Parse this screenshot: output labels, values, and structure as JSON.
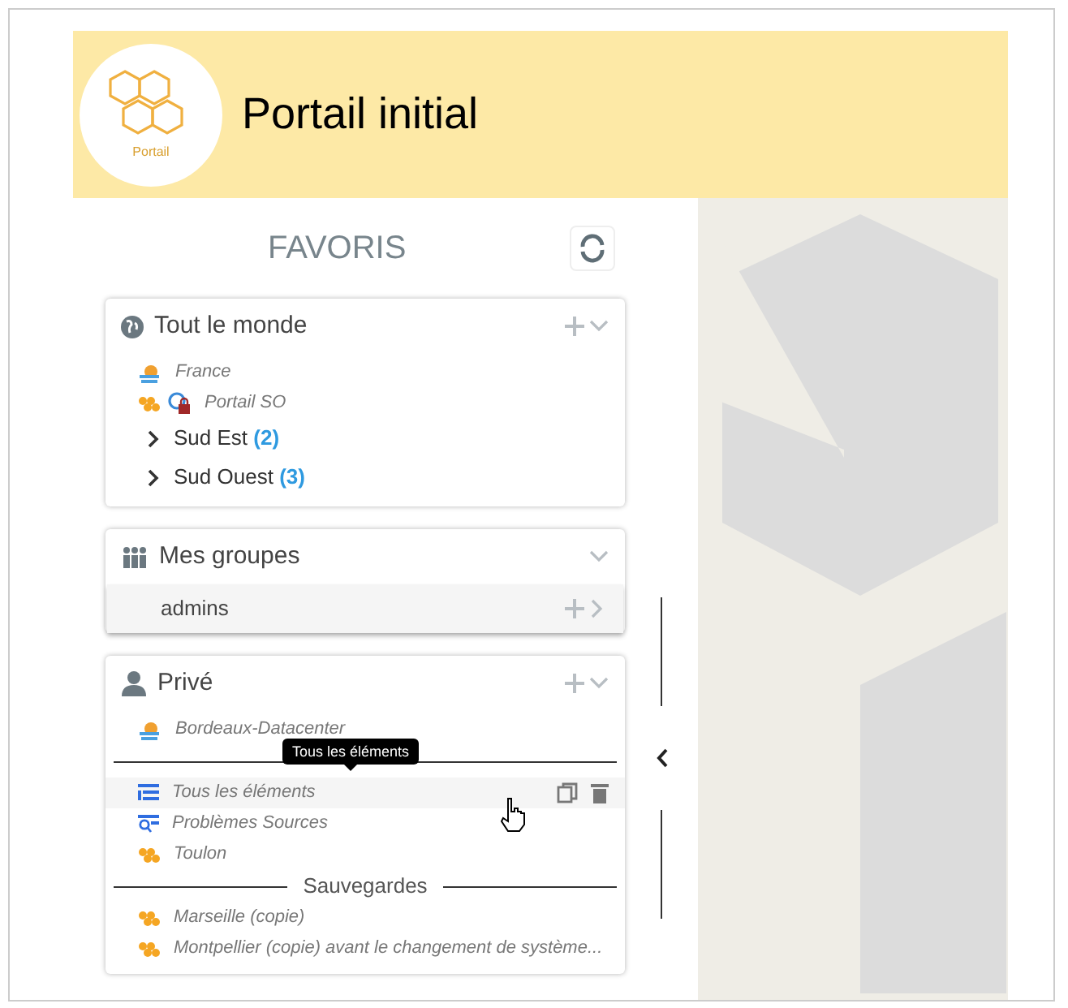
{
  "header": {
    "logo_text": "Portail",
    "title": "Portail initial"
  },
  "favorites": {
    "title": "FAVORIS"
  },
  "groups": [
    {
      "title": "Tout le monde",
      "kind": "public",
      "can_add": true,
      "expanded": true,
      "items": [
        {
          "kind": "map",
          "label": "France",
          "hovered": false
        },
        {
          "kind": "shared",
          "label": "Portail SO",
          "hovered": false
        },
        {
          "kind": "folder",
          "label": "Sud Est",
          "count": "(2)"
        },
        {
          "kind": "folder",
          "label": "Sud Ouest",
          "count": "(3)"
        }
      ]
    },
    {
      "title": "Mes groupes",
      "kind": "team",
      "can_add": false,
      "expanded": true,
      "items": [
        {
          "kind": "subgroup",
          "label": "admins"
        }
      ]
    },
    {
      "title": "Privé",
      "kind": "private",
      "can_add": true,
      "expanded": true,
      "items": [
        {
          "kind": "map",
          "label": "Bordeaux-Datacenter",
          "hovered": false
        },
        {
          "kind": "separator"
        },
        {
          "kind": "view",
          "label": "Tous les éléments",
          "hovered": true,
          "tooltip": "Tous les éléments"
        },
        {
          "kind": "query",
          "label": "Problèmes Sources",
          "hovered": false
        },
        {
          "kind": "portal",
          "label": "Toulon",
          "hovered": false
        },
        {
          "kind": "separator",
          "label": "Sauvegardes"
        },
        {
          "kind": "portal",
          "label": "Marseille (copie)",
          "hovered": false
        },
        {
          "kind": "portal",
          "label": "Montpellier (copie) avant le changement de systѐme...",
          "hovered": false
        }
      ]
    }
  ]
}
